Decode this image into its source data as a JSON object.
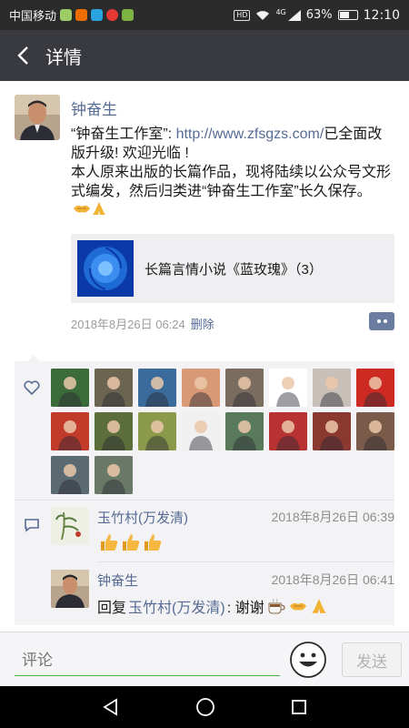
{
  "status_bar": {
    "carrier": "中国移动",
    "network_badge": "HD",
    "signal": "4G",
    "battery_text": "63%",
    "battery_level": 0.63,
    "time": "12:10"
  },
  "header": {
    "title": "详情"
  },
  "post": {
    "author": "钟奋生",
    "text_prefix": "“钟奋生工作室”: ",
    "link_text": "http://www.zfsgzs.com/",
    "text_rest": "已全面改版升级! 欢迎光临 !",
    "text_line2": "本人原来出版的长篇作品，现将陆续以公众号文形式编发，然后归类进“钟奋生工作室”长久保存。",
    "share_card_title": "长篇言情小说《蓝玫瑰》（3）",
    "timestamp": "2018年8月26日 06:24",
    "delete_label": "删除"
  },
  "likes": {
    "avatar_colors": [
      "#3c6b3a",
      "#6a6450",
      "#3b6b9a",
      "#d89a76",
      "#7a6d60",
      "#ffffff",
      "#c8c0b8",
      "#cc2a22",
      "#c23a2a",
      "#5c6e3a",
      "#8a9a4a",
      "#f0f0f0",
      "#587a5a",
      "#b83232",
      "#8a3830",
      "#7a5a48",
      "#5a6a70",
      "#6a7868"
    ]
  },
  "comments": [
    {
      "name": "玉竹村(万发清)",
      "time": "2018年8月26日 06:39",
      "body": ""
    },
    {
      "name": "钟奋生",
      "time": "2018年8月26日 06:41",
      "reply_prefix": "回复",
      "reply_to": "玉竹村(万发清)",
      "reply_text": ": 谢谢"
    }
  ],
  "input": {
    "placeholder": "评论",
    "send_label": "发送"
  },
  "icons": [
    "back-arrow-icon",
    "heart-icon",
    "comment-icon",
    "emoji-icon",
    "thumbs-up-icon",
    "coffee-icon",
    "handshake-icon",
    "pray-icon",
    "nav-back-icon",
    "nav-home-icon",
    "nav-recents-icon"
  ]
}
